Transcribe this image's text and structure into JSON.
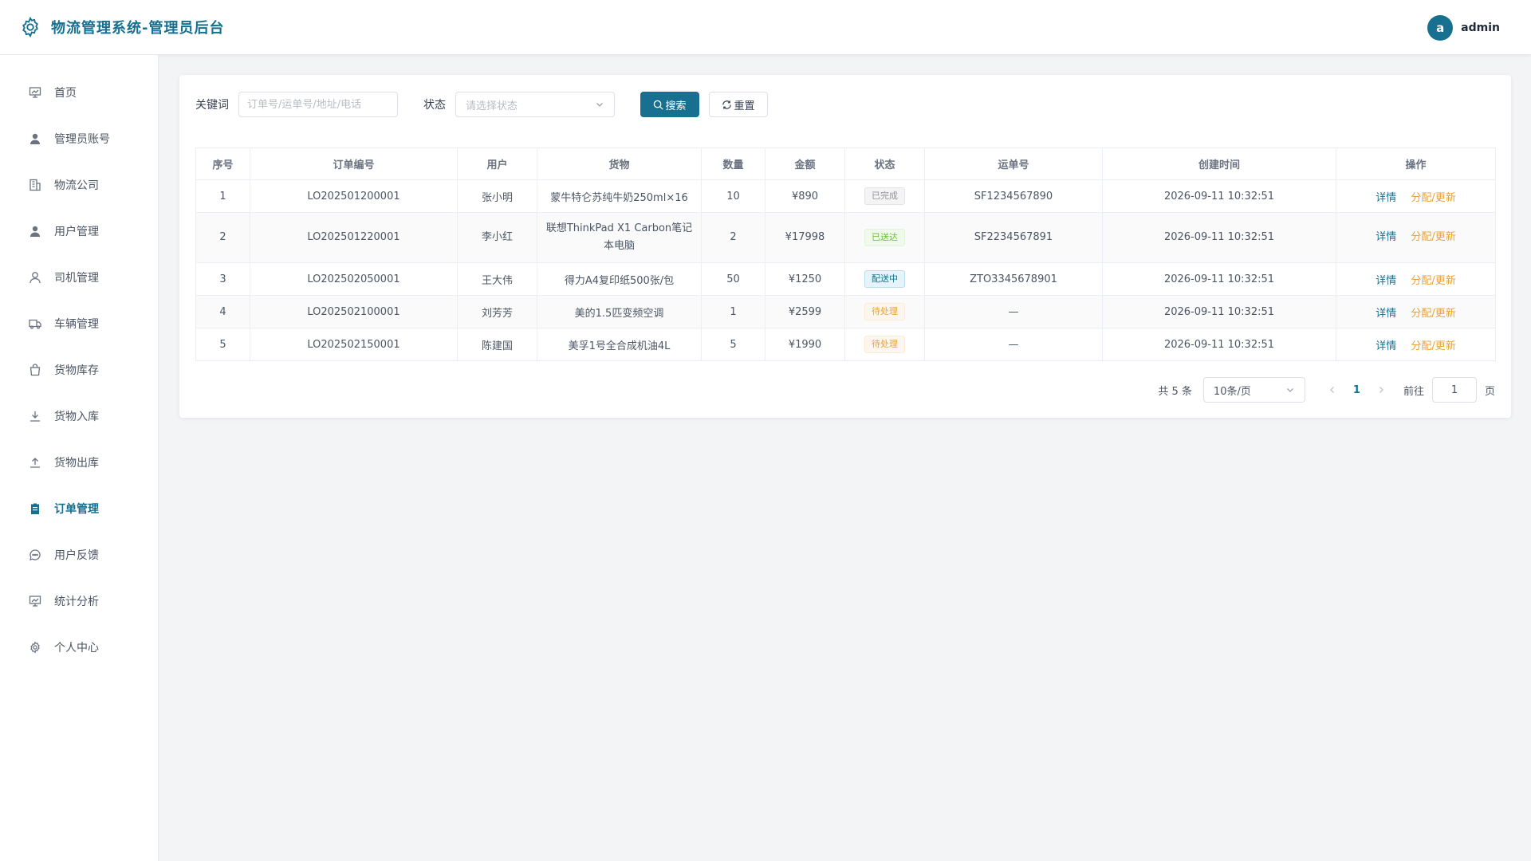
{
  "header": {
    "title": "物流管理系统-管理员后台",
    "avatar_letter": "a",
    "username": "admin"
  },
  "sidebar": {
    "items": [
      {
        "label": "首页",
        "icon": "dashboard-icon"
      },
      {
        "label": "管理员账号",
        "icon": "user-filled-icon"
      },
      {
        "label": "物流公司",
        "icon": "building-icon"
      },
      {
        "label": "用户管理",
        "icon": "user-filled-icon"
      },
      {
        "label": "司机管理",
        "icon": "user-outline-icon"
      },
      {
        "label": "车辆管理",
        "icon": "truck-icon"
      },
      {
        "label": "货物库存",
        "icon": "bag-icon"
      },
      {
        "label": "货物入库",
        "icon": "download-icon"
      },
      {
        "label": "货物出库",
        "icon": "upload-icon"
      },
      {
        "label": "订单管理",
        "icon": "clipboard-icon",
        "active": true
      },
      {
        "label": "用户反馈",
        "icon": "chat-icon"
      },
      {
        "label": "统计分析",
        "icon": "chart-icon"
      },
      {
        "label": "个人中心",
        "icon": "gear-icon"
      }
    ]
  },
  "filters": {
    "keyword_label": "关键词",
    "keyword_placeholder": "订单号/运单号/地址/电话",
    "status_label": "状态",
    "status_placeholder": "请选择状态",
    "search_label": "搜索",
    "reset_label": "重置"
  },
  "table": {
    "headers": [
      "序号",
      "订单编号",
      "用户",
      "货物",
      "数量",
      "金额",
      "状态",
      "运单号",
      "创建时间",
      "操作"
    ],
    "rows": [
      {
        "idx": "1",
        "order_no": "LO202501200001",
        "user": "张小明",
        "goods": "蒙牛特仑苏纯牛奶250ml×16",
        "qty": "10",
        "amount": "¥890",
        "status": "已完成",
        "status_type": "done",
        "waybill": "SF1234567890",
        "created": "2026-09-11 10:32:51"
      },
      {
        "idx": "2",
        "order_no": "LO202501220001",
        "user": "李小红",
        "goods": "联想ThinkPad X1 Carbon笔记本电脑",
        "qty": "2",
        "amount": "¥17998",
        "status": "已送达",
        "status_type": "delivered",
        "waybill": "SF2234567891",
        "created": "2026-09-11 10:32:51"
      },
      {
        "idx": "3",
        "order_no": "LO202502050001",
        "user": "王大伟",
        "goods": "得力A4复印纸500张/包",
        "qty": "50",
        "amount": "¥1250",
        "status": "配送中",
        "status_type": "shipping",
        "waybill": "ZTO3345678901",
        "created": "2026-09-11 10:32:51"
      },
      {
        "idx": "4",
        "order_no": "LO202502100001",
        "user": "刘芳芳",
        "goods": "美的1.5匹变频空调",
        "qty": "1",
        "amount": "¥2599",
        "status": "待处理",
        "status_type": "pending",
        "waybill": "—",
        "created": "2026-09-11 10:32:51"
      },
      {
        "idx": "5",
        "order_no": "LO202502150001",
        "user": "陈建国",
        "goods": "美孚1号全合成机油4L",
        "qty": "5",
        "amount": "¥1990",
        "status": "待处理",
        "status_type": "pending",
        "waybill": "—",
        "created": "2026-09-11 10:32:51"
      }
    ],
    "op_detail": "详情",
    "op_assign": "分配/更新"
  },
  "pagination": {
    "total_text": "共 5 条",
    "page_size": "10条/页",
    "current_page": "1",
    "goto_label": "前往",
    "goto_value": "1",
    "page_suffix": "页"
  },
  "colors": {
    "primary": "#17708f",
    "warning": "#e6a23c",
    "success": "#67c23a"
  }
}
